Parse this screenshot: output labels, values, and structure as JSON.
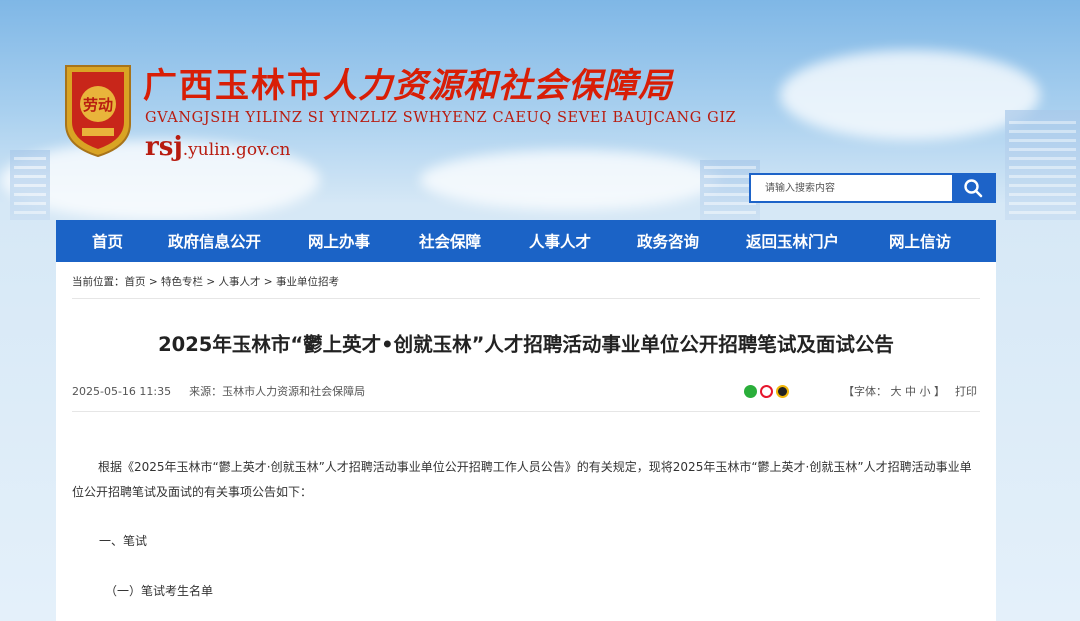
{
  "header": {
    "title_part1": "广西玉林市",
    "title_part2": "人力资源和社会保障局",
    "title_zhuang": "GVANGJSIH YILINZ SI YINZLIZ SWHYENZ CAEUQ SEVEI BAUJCANG GIZ",
    "domain_prefix": "rsj",
    "domain_suffix": ".yulin.gov.cn",
    "emblem_text": "劳动"
  },
  "search": {
    "placeholder": "请输入搜索内容",
    "button_icon": "search-icon"
  },
  "nav": {
    "items": [
      "首页",
      "政府信息公开",
      "网上办事",
      "社会保障",
      "人事人才",
      "政务咨询",
      "返回玉林门户",
      "网上信访"
    ]
  },
  "breadcrumb": {
    "label": "当前位置：",
    "items": [
      "首页",
      "特色专栏",
      "人事人才",
      "事业单位招考"
    ],
    "separator": " > "
  },
  "article": {
    "title": "2025年玉林市“鬱上英才•创就玉林”人才招聘活动事业单位公开招聘笔试及面试公告",
    "date": "2025-05-16 11:35",
    "source": "来源：玉林市人力资源和社会保障局",
    "share_icons": [
      "wechat-icon",
      "weibo-icon",
      "qq-icon"
    ],
    "font_size_label": "【字体：",
    "font_large": "大",
    "font_medium": "中",
    "font_small": "小",
    "font_size_close": "】",
    "print_label": "打印",
    "paragraphs": [
      "根据《2025年玉林市“鬱上英才·创就玉林”人才招聘活动事业单位公开招聘工作人员公告》的有关规定，现将2025年玉林市“鬱上英才·创就玉林”人才招聘活动事业单位公开招聘笔试及面试的有关事项公告如下：",
      "一、笔试",
      "（一）笔试考生名单"
    ]
  },
  "colors": {
    "nav_bg": "#1b63c6",
    "brand_red": "#d81e06",
    "search_blue": "#1d63c8"
  }
}
